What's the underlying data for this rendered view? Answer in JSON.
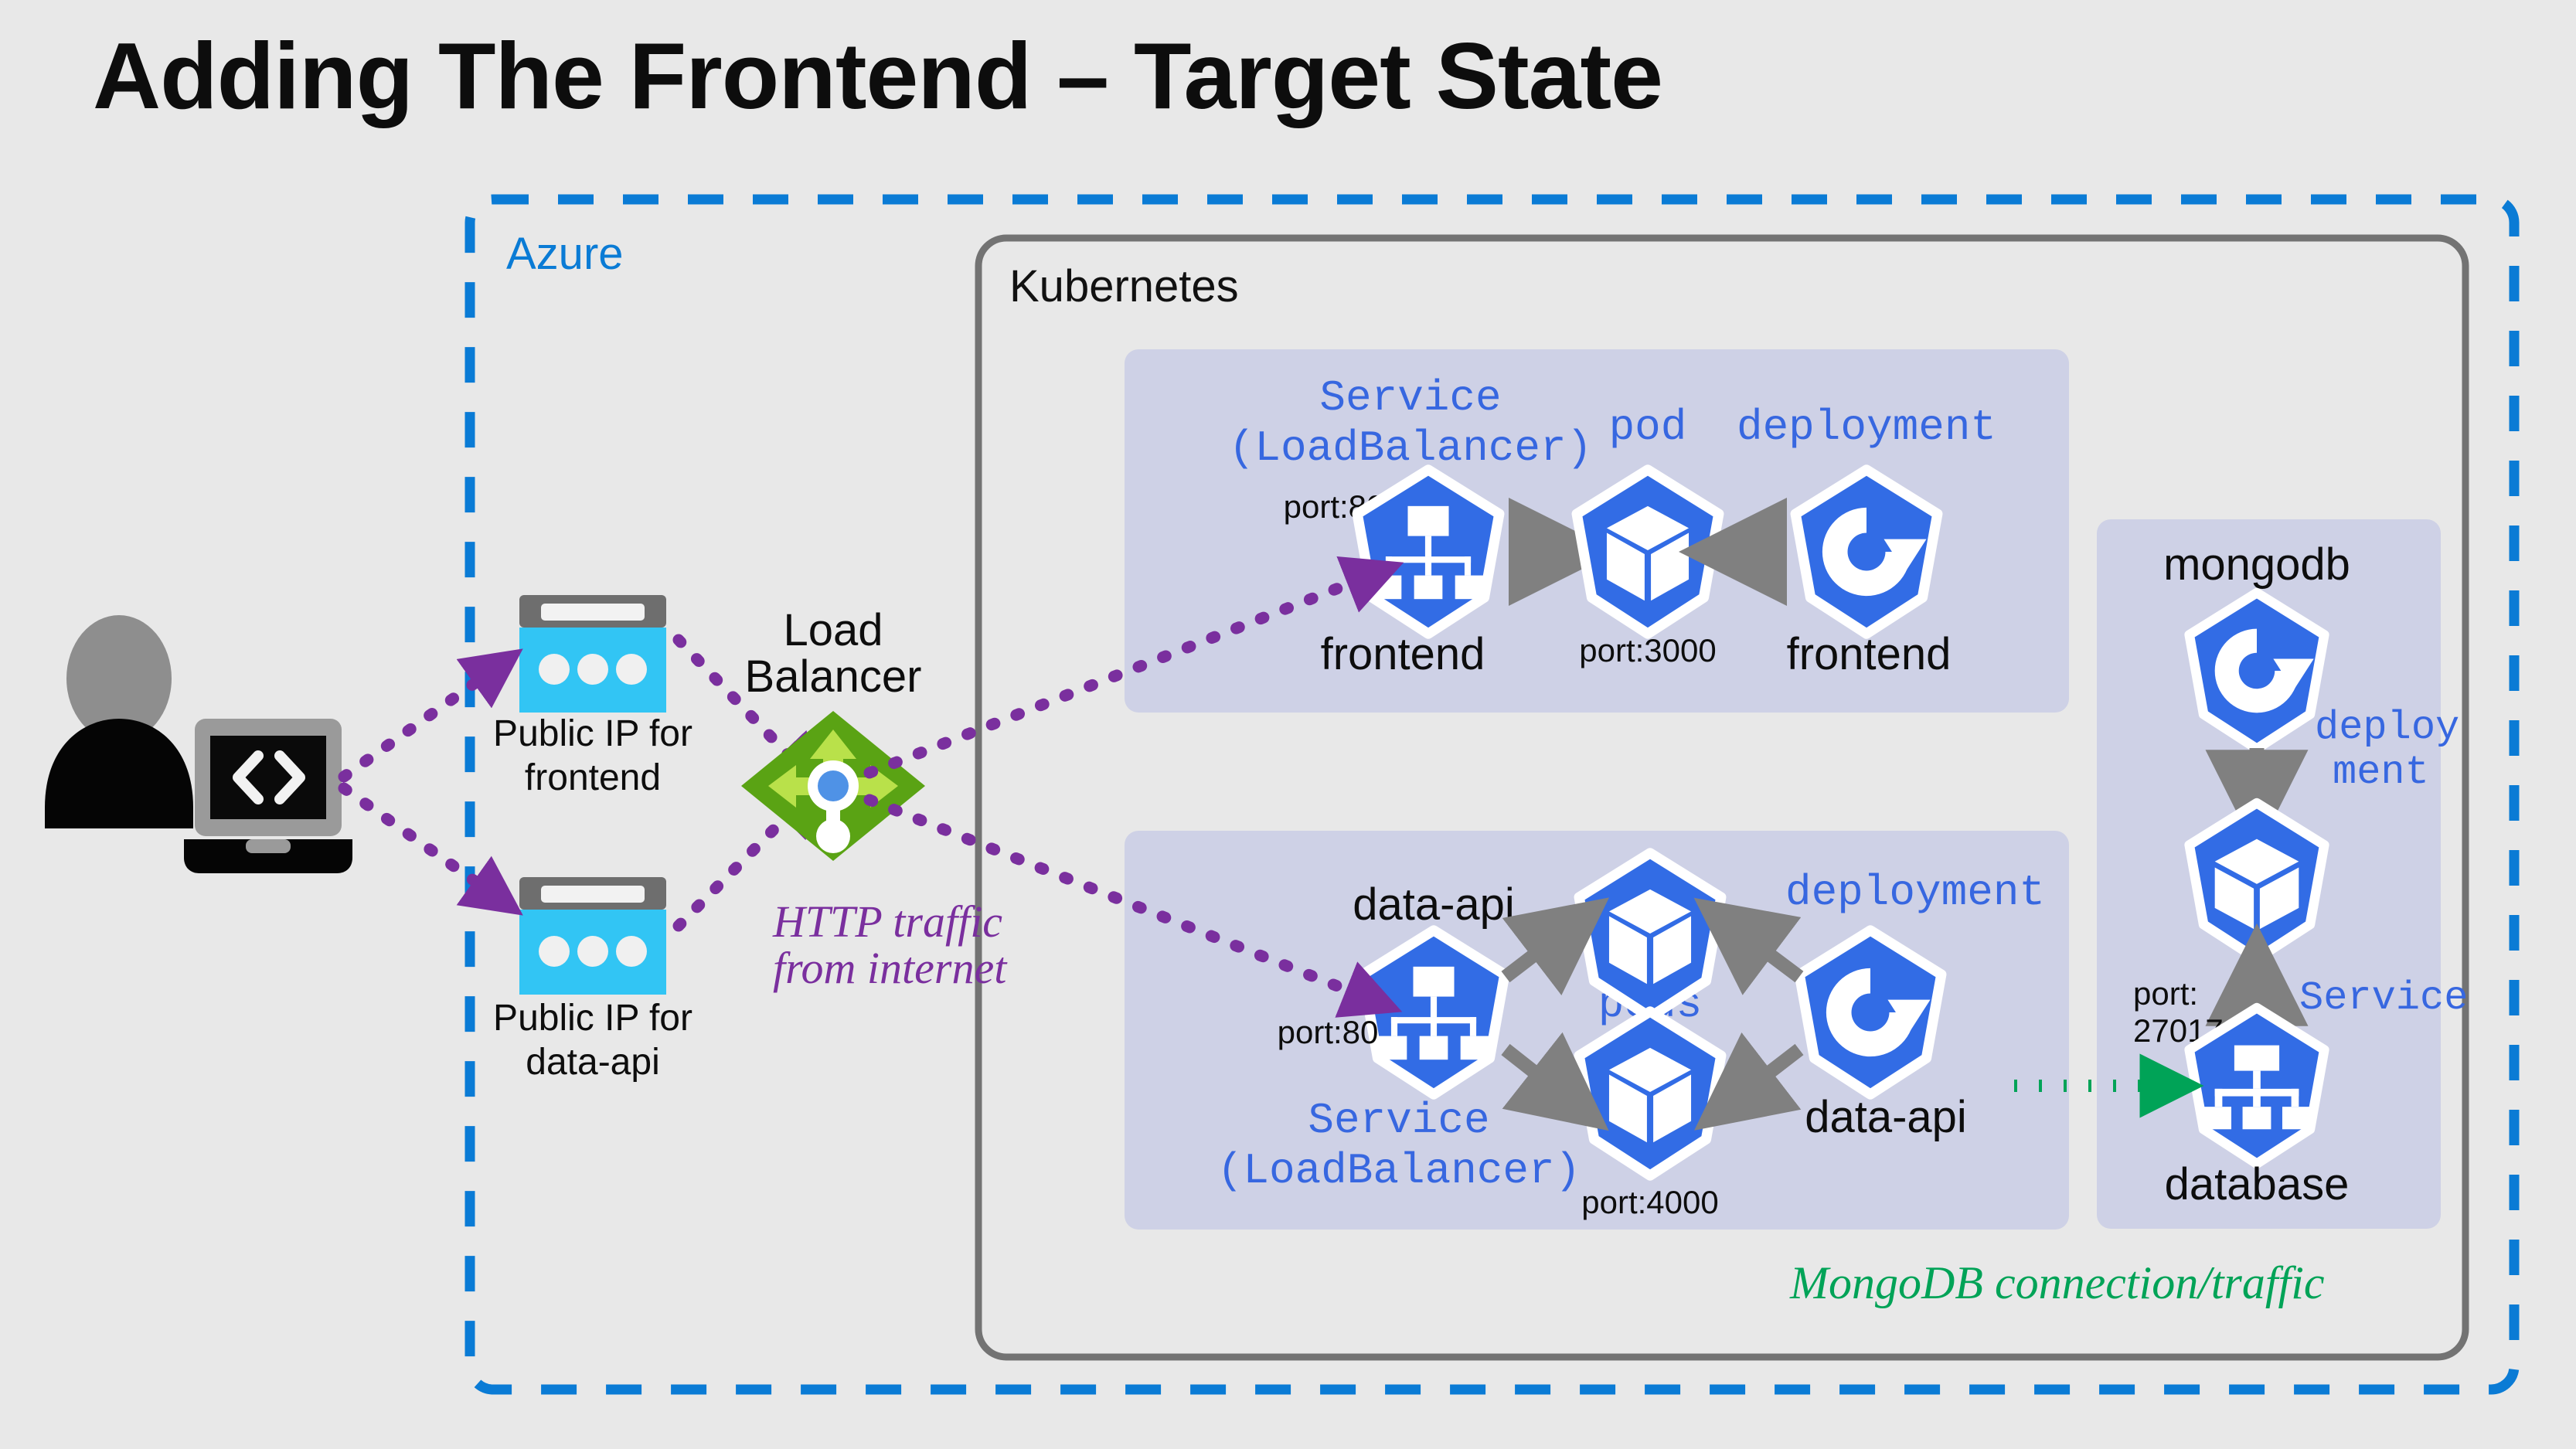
{
  "title": "Adding The Frontend – Target State",
  "colors": {
    "background": "#e8e8e8",
    "azure_border": "#0a7bd5",
    "kubernetes_border": "#737373",
    "panel_fill": "#ced1e6",
    "k8s_blue": "#326ce5",
    "k8s_text_blue": "#3767e0",
    "arrow_gray": "#808080",
    "http_purple": "#7a2f9e",
    "mongo_green": "#00a357",
    "lb_green": "#5aa314",
    "public_ip_cyan": "#32c5f4"
  },
  "containers": {
    "azure": {
      "label": "Azure"
    },
    "kubernetes": {
      "label": "Kubernetes"
    }
  },
  "client": {
    "user_icon": "person-icon",
    "laptop_icon": "laptop-code-icon"
  },
  "public_ips": [
    {
      "id": "public-ip-frontend",
      "label_line1": "Public IP for",
      "label_line2": "frontend",
      "icon": "public-ip-icon"
    },
    {
      "id": "public-ip-data-api",
      "label_line1": "Public IP for",
      "label_line2": "data-api",
      "icon": "public-ip-icon"
    }
  ],
  "load_balancer": {
    "label_line1": "Load",
    "label_line2": "Balancer",
    "icon": "load-balancer-icon",
    "caption_line1": "HTTP traffic",
    "caption_line2": "from internet"
  },
  "frontend_panel": {
    "service_label_line1": "Service",
    "service_label_line2": "(LoadBalancer)",
    "service_name": "frontend",
    "service_port": "port:80",
    "service_icon": "k8s-service-icon",
    "pod_label": "pod",
    "pod_port": "port:3000",
    "pod_icon": "k8s-pod-icon",
    "deployment_label": "deployment",
    "deployment_name": "frontend",
    "deployment_icon": "k8s-deployment-icon"
  },
  "data_api_panel": {
    "service_label_line1": "Service",
    "service_label_line2": "(LoadBalancer)",
    "service_name": "data-api",
    "service_port": "port:80",
    "service_icon": "k8s-service-icon",
    "pods_label": "pods",
    "pods_port": "port:4000",
    "pod_icon": "k8s-pod-icon",
    "deployment_label": "deployment",
    "deployment_name": "data-api",
    "deployment_icon": "k8s-deployment-icon"
  },
  "mongodb_panel": {
    "title": "mongodb",
    "deployment_label_line1": "deploy",
    "deployment_label_line2": "ment",
    "deployment_icon": "k8s-deployment-icon",
    "pod_icon": "k8s-pod-icon",
    "service_label": "Service",
    "service_name": "database",
    "service_icon": "k8s-service-icon",
    "port_line1": "port:",
    "port_line2": "27017"
  },
  "mongo_caption": "MongoDB connection/traffic"
}
